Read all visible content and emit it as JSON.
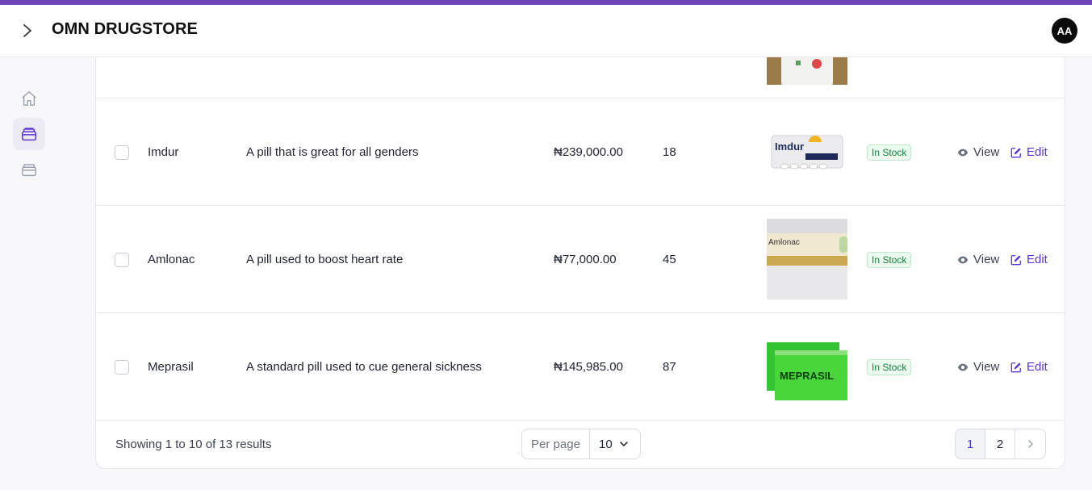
{
  "app": {
    "title": "OMN DRUGSTORE",
    "avatar_initials": "AA",
    "accent_color": "#6d44b8"
  },
  "sidebar": {
    "items": [
      {
        "icon": "home-icon"
      },
      {
        "icon": "products-icon",
        "active": true
      },
      {
        "icon": "orders-icon"
      }
    ]
  },
  "products": [
    {
      "name": "Imdur",
      "description": "A pill that is great for all genders",
      "price": "₦239,000.00",
      "quantity": "18",
      "image_label": "Imdur",
      "status": "In Stock",
      "view_label": "View",
      "edit_label": "Edit"
    },
    {
      "name": "Amlonac",
      "description": "A pill used to boost heart rate",
      "price": "₦77,000.00",
      "quantity": "45",
      "image_label": "Amlonac",
      "status": "In Stock",
      "view_label": "View",
      "edit_label": "Edit"
    },
    {
      "name": "Meprasil",
      "description": "A standard pill used to cue general sickness",
      "price": "₦145,985.00",
      "quantity": "87",
      "image_label": "MEPRASIL",
      "status": "In Stock",
      "view_label": "View",
      "edit_label": "Edit"
    }
  ],
  "footer": {
    "showing": "Showing 1 to 10 of 13 results",
    "per_page_label": "Per page",
    "per_page_value": "10",
    "pages": [
      "1",
      "2"
    ],
    "current_page": "1"
  }
}
